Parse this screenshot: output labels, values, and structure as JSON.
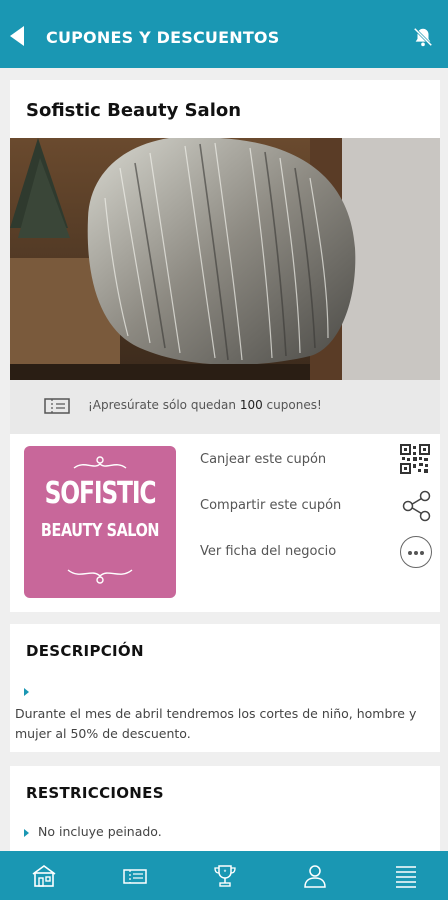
{
  "header": {
    "title": "CUPONES Y DESCUENTOS",
    "back_icon": "back-arrow-icon",
    "notifications_icon": "bell-off-icon",
    "background_color": "#1a97b3"
  },
  "coupon": {
    "business_name": "Sofistic Beauty Salon",
    "remaining_prefix": "¡Apresúrate sólo quedan ",
    "remaining_count": "100",
    "remaining_suffix": " cupones!",
    "logo": {
      "line1": "SOFISTIC",
      "line2": "BEAUTY SALON",
      "background_color": "#c8679a"
    },
    "actions": {
      "redeem": "Canjear este cupón",
      "share": "Compartir este cupón",
      "business_details": "Ver ficha del negocio"
    }
  },
  "description": {
    "title": "DESCRIPCIÓN",
    "text": "Durante el mes de abril tendremos los cortes de niño, hombre y mujer al 50% de descuento."
  },
  "restrictions": {
    "title": "RESTRICCIONES",
    "items": [
      "No incluye peinado."
    ]
  },
  "bottom_nav": {
    "items": [
      "home-icon",
      "coupons-icon",
      "trophy-icon",
      "profile-icon",
      "menu-icon"
    ]
  }
}
